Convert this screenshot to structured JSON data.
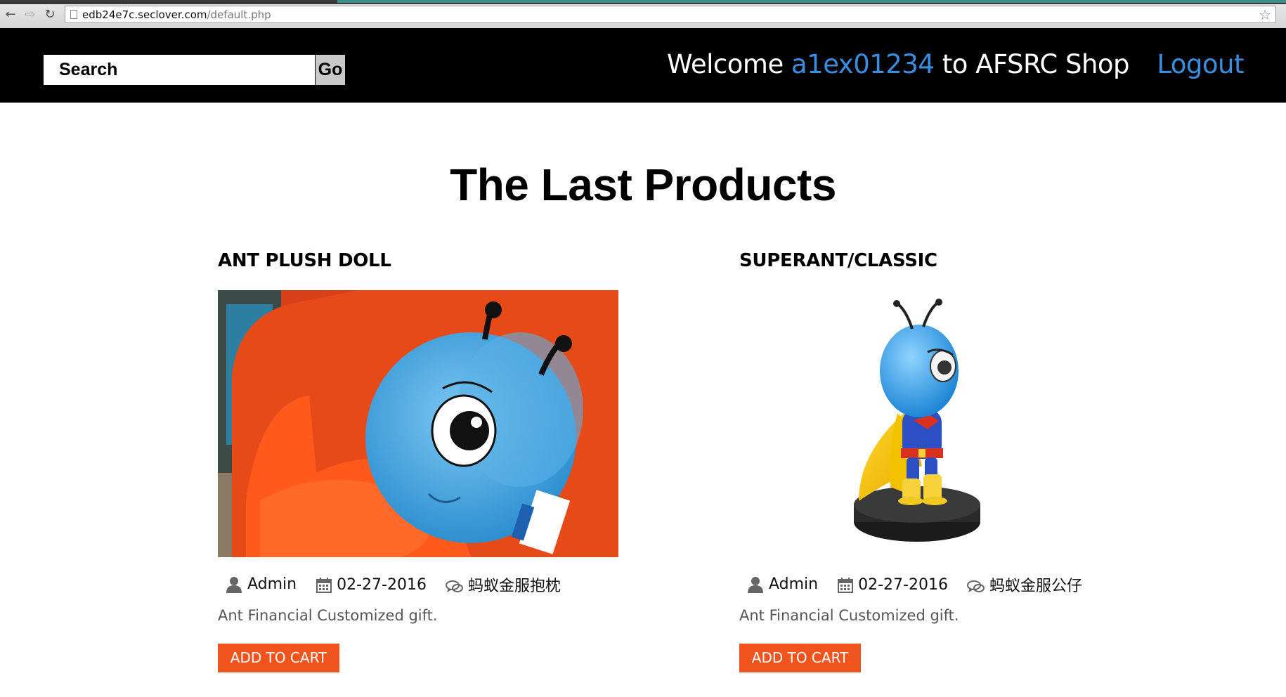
{
  "browser": {
    "url_host": "edb24e7c.seclover.com",
    "url_path": "/default.php"
  },
  "header": {
    "search_placeholder": "Search",
    "go_label": "Go",
    "welcome_prefix": "Welcome",
    "username": "a1ex01234",
    "welcome_suffix": "to AFSRC Shop",
    "logout_label": "Logout"
  },
  "main": {
    "title": "The Last Products",
    "products": [
      {
        "name": "ANT PLUSH DOLL",
        "author": "Admin",
        "date": "02-27-2016",
        "tag": "蚂蚁金服抱枕",
        "description": "Ant Financial Customized gift.",
        "cart_label": "ADD TO CART",
        "image_icon": "ant-plush-doll-photo"
      },
      {
        "name": "SUPERANT/CLASSIC",
        "author": "Admin",
        "date": "02-27-2016",
        "tag": "蚂蚁金服公仔",
        "description": "Ant Financial Customized gift.",
        "cart_label": "ADD TO CART",
        "image_icon": "superant-figure-photo"
      }
    ]
  },
  "colors": {
    "header_bg": "#000000",
    "link_blue": "#3a8ee0",
    "cart_orange": "#f0541e"
  }
}
